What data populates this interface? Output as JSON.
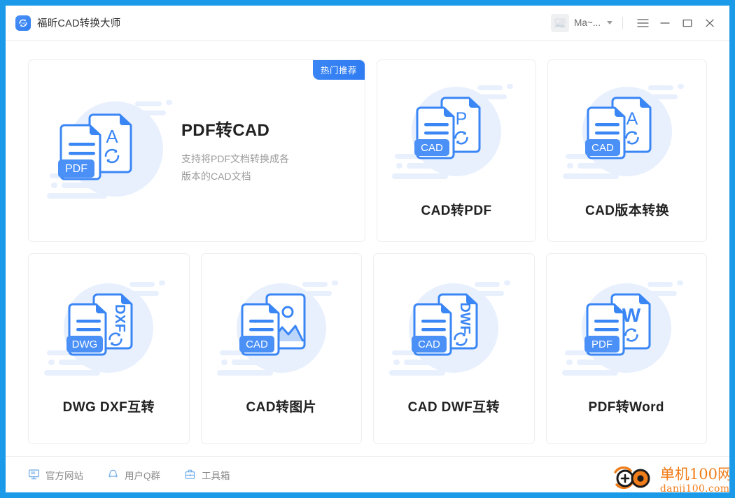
{
  "window": {
    "title": "福昕CAD转换大师",
    "logo_icon": "cad-convert-logo-icon",
    "account": {
      "avatar_icon": "broken-image-avatar-icon",
      "name": "Ma~...",
      "dropdown_icon": "chevron-down-icon"
    },
    "controls": {
      "menu_icon": "hamburger-menu-icon",
      "minimize_icon": "minimize-icon",
      "maximize_icon": "maximize-icon",
      "close_icon": "close-icon"
    }
  },
  "hero": {
    "badge": "热门推荐",
    "title": "PDF转CAD",
    "desc_line1": "支持将PDF文档转换成各",
    "desc_line2": "版本的CAD文档",
    "front_label": "PDF",
    "back_glyph": "A",
    "back_glyph_vertical": false,
    "back_icon": "sync-arrows-icon",
    "illustration": "pdf-to-cad-illustration"
  },
  "cards": [
    {
      "id": "cad-to-pdf",
      "title": "CAD转PDF",
      "front_label": "CAD",
      "back_glyph": "P",
      "back_glyph_vertical": false,
      "back_icon": "sync-arrows-icon",
      "illustration": "cad-to-pdf-illustration"
    },
    {
      "id": "cad-version-convert",
      "title": "CAD版本转换",
      "front_label": "CAD",
      "back_glyph": "A",
      "back_glyph_vertical": false,
      "back_icon": "sync-arrows-icon",
      "illustration": "cad-version-convert-illustration"
    },
    {
      "id": "dwg-dxf",
      "title": "DWG DXF互转",
      "front_label": "DWG",
      "back_glyph": "DXF",
      "back_glyph_vertical": true,
      "back_icon": "sync-arrows-icon",
      "illustration": "dwg-dxf-illustration"
    },
    {
      "id": "cad-to-image",
      "title": "CAD转图片",
      "front_label": "CAD",
      "back_glyph": "",
      "back_glyph_vertical": false,
      "back_icon": "picture-icon",
      "illustration": "cad-to-image-illustration"
    },
    {
      "id": "cad-dwf",
      "title": "CAD DWF互转",
      "front_label": "CAD",
      "back_glyph": "DWF",
      "back_glyph_vertical": true,
      "back_icon": "sync-arrows-icon",
      "illustration": "cad-dwf-illustration"
    },
    {
      "id": "pdf-to-word",
      "title": "PDF转Word",
      "front_label": "PDF",
      "back_glyph": "W",
      "back_glyph_vertical": false,
      "back_icon": "sync-arrows-icon",
      "illustration": "pdf-to-word-illustration"
    }
  ],
  "footer": {
    "items": [
      {
        "label": "官方网站",
        "icon": "monitor-icon"
      },
      {
        "label": "用户Q群",
        "icon": "qq-penguin-icon"
      },
      {
        "label": "工具箱",
        "icon": "toolbox-icon"
      }
    ]
  },
  "watermark": {
    "main": "单机100网",
    "sub": "danji100.com",
    "logo_icon": "danji100-logo-icon"
  },
  "colors": {
    "accent": "#3a86f5",
    "accent_dark": "#2f7bf2",
    "illus_bg": "#e8f0fe",
    "card_border": "#ededed",
    "window_bg": "#1a9ae8",
    "title_text": "#333333",
    "muted_text": "#9b9b9b",
    "watermark": "#f07d1a"
  }
}
